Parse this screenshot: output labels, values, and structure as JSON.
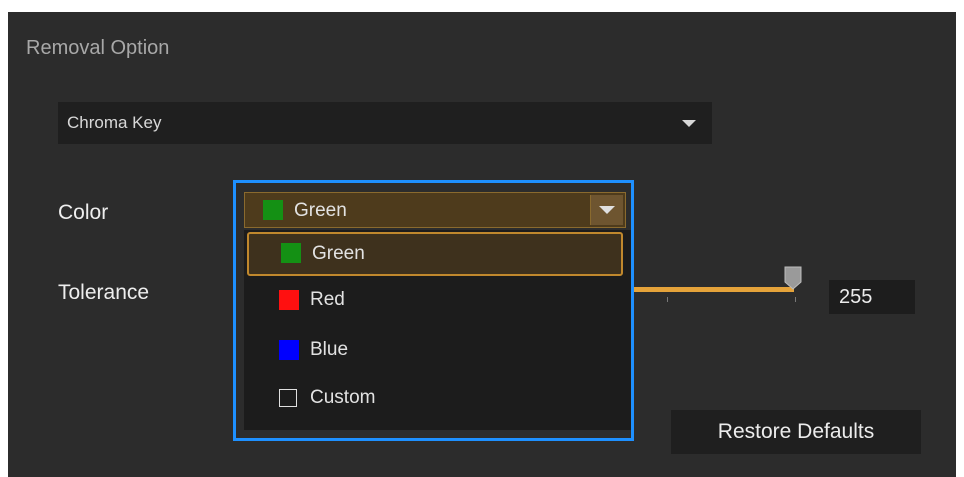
{
  "section": {
    "title": "Removal Option"
  },
  "method": {
    "value": "Chroma Key"
  },
  "color": {
    "label": "Color",
    "selected": {
      "label": "Green",
      "swatch": "#149014"
    },
    "options": [
      {
        "label": "Green",
        "swatch": "#149014"
      },
      {
        "label": "Red",
        "swatch": "#ff1010"
      },
      {
        "label": "Blue",
        "swatch": "#0000ff"
      },
      {
        "label": "Custom"
      }
    ]
  },
  "tolerance": {
    "label": "Tolerance",
    "value": "255",
    "fill_fraction": 1.0
  },
  "restore": {
    "label": "Restore Defaults"
  },
  "colors": {
    "accent": "#e5a33a",
    "focus_outline": "#1e90ff",
    "panel_bg": "#2c2c2c"
  },
  "icons": {
    "dropdown": "chevron-down-icon",
    "slider": "slider-thumb"
  }
}
